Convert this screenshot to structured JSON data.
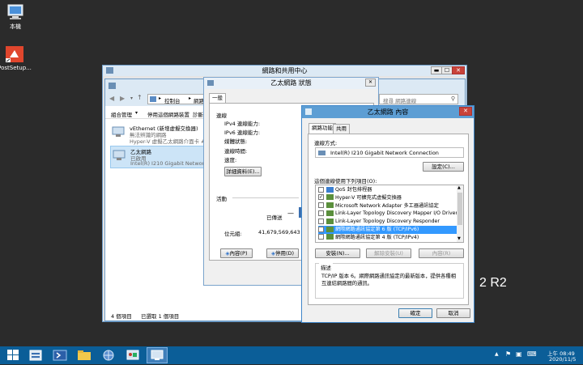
{
  "desktop": {
    "icons": [
      {
        "label": "本機"
      },
      {
        "label": "PostSetup..."
      }
    ],
    "watermark": "2 R2"
  },
  "network_center": {
    "title": "網路和共用中心",
    "controls": {
      "minimize": "▬",
      "maximize": "☐",
      "close": "✕"
    }
  },
  "connections_window": {
    "breadcrumb": [
      "控制台",
      "網路和"
    ],
    "search_placeholder": "搜尋 網路連線",
    "toolbar": {
      "organize": "組合管理",
      "disable": "停用這個網路裝置",
      "diagnose": "診斷"
    },
    "adapters": [
      {
        "name": "vEthernet (新增虛擬交換器)",
        "status": "無法辨識的網路",
        "device": "Hyper-V 虛擬乙太網路介面卡 #"
      },
      {
        "name": "乙太網路",
        "status": "已啟用",
        "device": "Intel(R) I210 Gigabit Network Co"
      }
    ],
    "status_bar": {
      "count": "4 個項目",
      "selected": "已選取 1 個項目"
    }
  },
  "status_dialog": {
    "title": "乙太網路 狀態",
    "tab": "一般",
    "connection_heading": "連線",
    "fields": [
      "IPv4 連線能力:",
      "IPv6 連線能力:",
      "媒體狀態:",
      "連線時間:",
      "速度:"
    ],
    "details_button": "詳細資料(E)...",
    "activity_heading": "活動",
    "sent_label": "已傳送",
    "bytes_label": "位元組:",
    "bytes_value": "41,679,569,643",
    "properties_button": "內容(P)",
    "disable_button": "停用(D)",
    "diagnose_button": "診"
  },
  "props_dialog": {
    "title": "乙太網路 內容",
    "tabs": [
      "網路功能",
      "共用"
    ],
    "connect_using_label": "連線方式:",
    "adapter": "Intel(R) I210 Gigabit Network Connection",
    "configure_button": "設定(C)...",
    "components_label": "這個連線使用下列項目(O):",
    "components": [
      {
        "label": "QoS 封包排程器",
        "checked": false,
        "selected": false,
        "color": "#3c7fd0"
      },
      {
        "label": "Hyper-V 可擴充式虛擬交換器",
        "checked": true,
        "selected": false,
        "color": "#5a8f3c"
      },
      {
        "label": "Microsoft Network Adapter 多工器通訊協定",
        "checked": false,
        "selected": false,
        "color": "#5a8f3c"
      },
      {
        "label": "Link-Layer Topology Discovery Mapper I/O Driver",
        "checked": false,
        "selected": false,
        "color": "#5a8f3c"
      },
      {
        "label": "Link-Layer Topology Discovery Responder",
        "checked": false,
        "selected": false,
        "color": "#5a8f3c"
      },
      {
        "label": "網際網路通訊協定第 6 版 (TCP/IPv6)",
        "checked": false,
        "selected": true,
        "color": "#5a8f3c"
      },
      {
        "label": "網際網路通訊協定第 4 版 (TCP/IPv4)",
        "checked": false,
        "selected": false,
        "color": "#5a8f3c"
      }
    ],
    "install_button": "安裝(N)...",
    "uninstall_button": "解除安裝(U)",
    "properties_button": "內容(R)",
    "description_heading": "描述",
    "description": "TCP/IP 版本 6。網際網路通訊協定的最新版本，提供各種相互連結網路間的通訊。",
    "ok_button": "確定",
    "cancel_button": "取消"
  },
  "taskbar": {
    "time": "上午 08:49",
    "date": "2020/11/5"
  }
}
